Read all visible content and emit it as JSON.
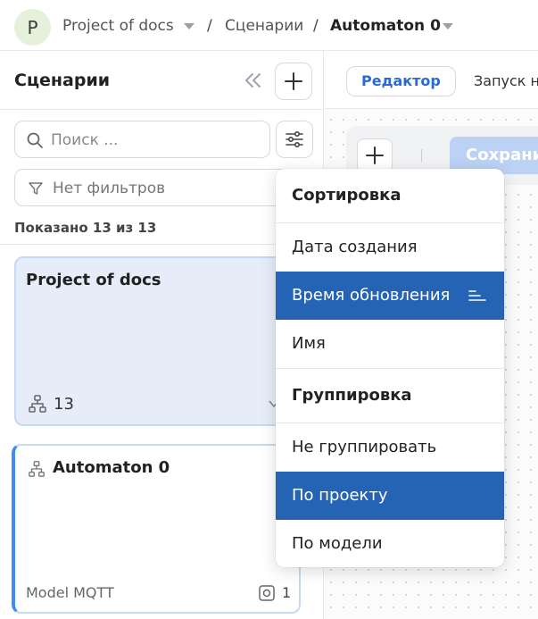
{
  "header": {
    "avatar_letter": "P",
    "project": "Project of docs",
    "separator": "/",
    "section": "Сценарии",
    "current": "Automaton 0"
  },
  "sidebar": {
    "title": "Сценарии",
    "search_placeholder": "Поиск ...",
    "filter_text": "Нет фильтров",
    "shown_count": "Показано 13 из 13",
    "cards": [
      {
        "title": "Project of docs",
        "count": "13"
      },
      {
        "title": "Automaton 0",
        "model": "Model MQTT",
        "device_count": "1"
      }
    ]
  },
  "editor": {
    "tabs": [
      "Редактор",
      "Запуск н"
    ],
    "save_label": "Сохрани"
  },
  "menu": {
    "sort_header": "Сортировка",
    "sort_items": [
      "Дата создания",
      "Время обновления",
      "Имя"
    ],
    "group_header": "Группировка",
    "group_items": [
      "Не группировать",
      "По проекту",
      "По модели"
    ]
  },
  "colors": {
    "accent": "#2563b5",
    "active_tab_text": "#2a6bd1",
    "card_selected_bg": "#e6edf8",
    "card_border_accent": "#3d8ef0"
  }
}
